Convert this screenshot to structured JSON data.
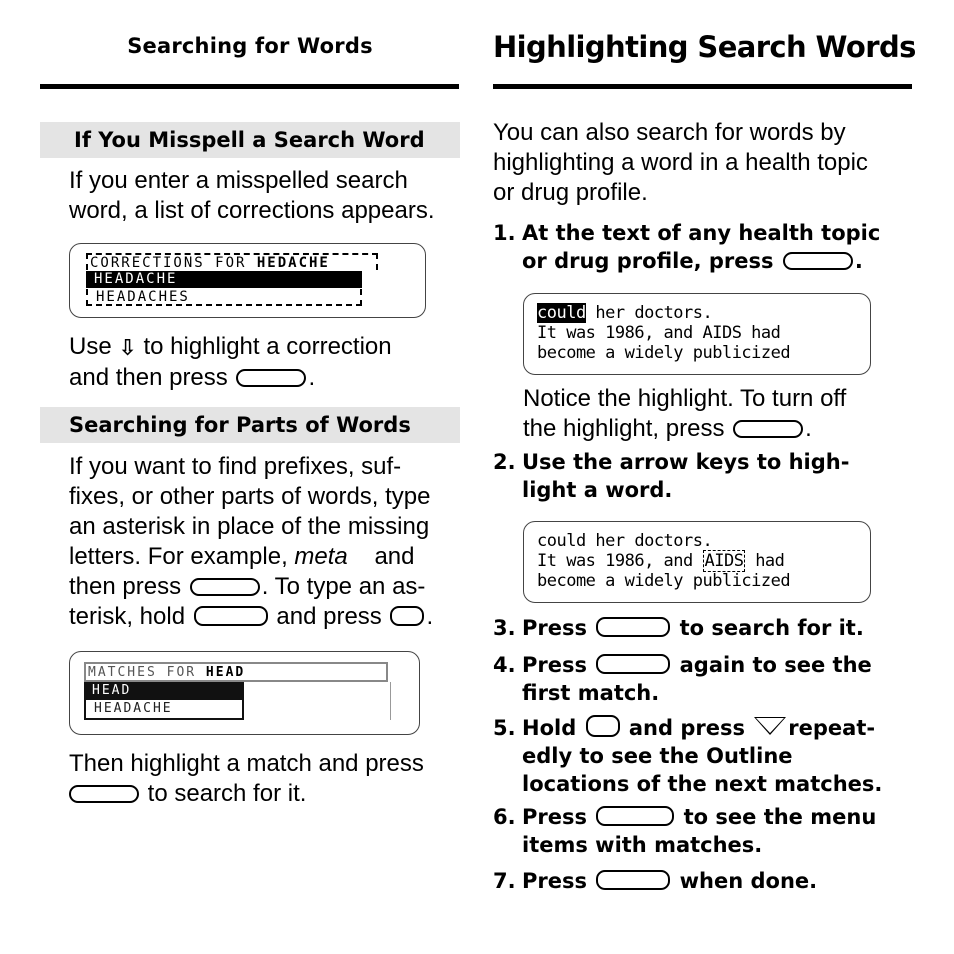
{
  "left_page": {
    "running_head": "Searching for Words",
    "section1": {
      "heading": "If You Misspell a Search Word",
      "intro": [
        "If you enter a misspelled search",
        "word, a list of corrections appears."
      ],
      "screen": {
        "header_prefix": "CORRECTIONS FOR ",
        "header_word": "HEDACHE",
        "items": [
          {
            "label": "HEADACHE",
            "selected": true
          },
          {
            "label": "HEADACHES",
            "selected": false
          }
        ]
      },
      "after": {
        "line1_a": "Use",
        "arrow_icon": "down-arrow-icon",
        "arrow_glyph": "⇩",
        "line1_b": "to highlight a correction",
        "line2": "and then press",
        "line2_end": "."
      }
    },
    "section2": {
      "heading": "Searching for Parts of Words",
      "lines": [
        "If you want to find prefixes, suf-",
        "fixes, or other parts of words, type",
        "an asterisk in place of the missing"
      ],
      "line4_a": "letters. For example,",
      "line4_example": "meta",
      "line4_b": "and",
      "line5_a": "then press",
      "line5_b": ".  To type an as-",
      "line6_a": "terisk, hold",
      "line6_b": "and press",
      "line6_end": ".",
      "screen": {
        "header_prefix": "MATCHES FOR ",
        "header_word": "HEAD",
        "items": [
          {
            "label": "HEAD",
            "selected": true
          },
          {
            "label": "HEADACHE",
            "selected": false
          }
        ]
      },
      "after_line1": "Then highlight a match and press",
      "after_line2": "to search for it."
    }
  },
  "right_page": {
    "title": "Highlighting Search Words",
    "intro": [
      "You can also search for words by",
      "highlighting a word in a health topic",
      "or drug profile."
    ],
    "steps": [
      {
        "num": "1.",
        "lines": [
          "At the text of any health topic",
          "or drug profile, press"
        ],
        "end": "."
      },
      {
        "num": "2.",
        "lines": [
          "Use the arrow keys to high-",
          "light a word."
        ]
      },
      {
        "num": "3.",
        "a": "Press",
        "b": "to search for it."
      },
      {
        "num": "4.",
        "a": "Press",
        "b": "again to see the",
        "cont": "first match."
      },
      {
        "num": "5.",
        "a": "Hold",
        "b": "and press",
        "c": "repeat-",
        "cont1": "edly to see the Outline",
        "cont2": "locations of the next matches."
      },
      {
        "num": "6.",
        "a": "Press",
        "b": "to see the menu",
        "cont": "items with matches."
      },
      {
        "num": "7.",
        "a": "Press",
        "b": "when done."
      }
    ],
    "screen1": {
      "line1_highlight": "could",
      "line1_rest": " her doctors.",
      "line2": "It was 1986, and AIDS had",
      "line3": "become a widely publicized"
    },
    "note": [
      "Notice the highlight. To turn off",
      "the highlight, press"
    ],
    "note_end": ".",
    "screen2": {
      "line1": "could her doctors.",
      "line2_a": "It was 1986, and ",
      "line2_highlight": "AIDS",
      "line2_b": " had",
      "line3": "become a widely publicized"
    }
  }
}
